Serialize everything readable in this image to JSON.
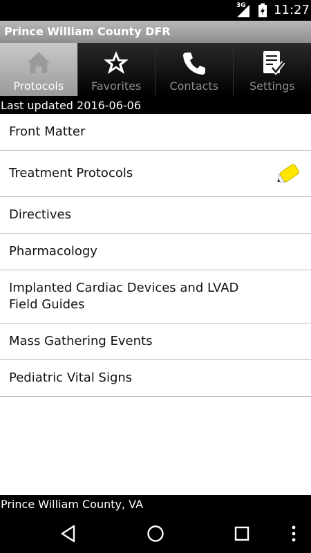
{
  "status_bar": {
    "network": "3G",
    "time": "11:27"
  },
  "app": {
    "title": "Prince William County DFR"
  },
  "tabs": [
    {
      "label": "Protocols",
      "icon": "home-icon",
      "active": true
    },
    {
      "label": "Favorites",
      "icon": "star-icon",
      "active": false
    },
    {
      "label": "Contacts",
      "icon": "phone-icon",
      "active": false
    },
    {
      "label": "Settings",
      "icon": "checklist-icon",
      "active": false
    }
  ],
  "updated": "Last updated 2016-06-06",
  "list": [
    {
      "label": "Front Matter"
    },
    {
      "label": "Treatment Protocols",
      "badge": "pencil-icon"
    },
    {
      "label": "Directives"
    },
    {
      "label": "Pharmacology"
    },
    {
      "label": "Implanted Cardiac Devices and LVAD Field Guides"
    },
    {
      "label": "Mass Gathering Events"
    },
    {
      "label": "Pediatric Vital Signs"
    }
  ],
  "footer": "Prince William County, VA",
  "colors": {
    "accent_yellow": "#ffe600",
    "title_bar": "#9e9e9e",
    "active_tab": "#b0b0b0"
  }
}
